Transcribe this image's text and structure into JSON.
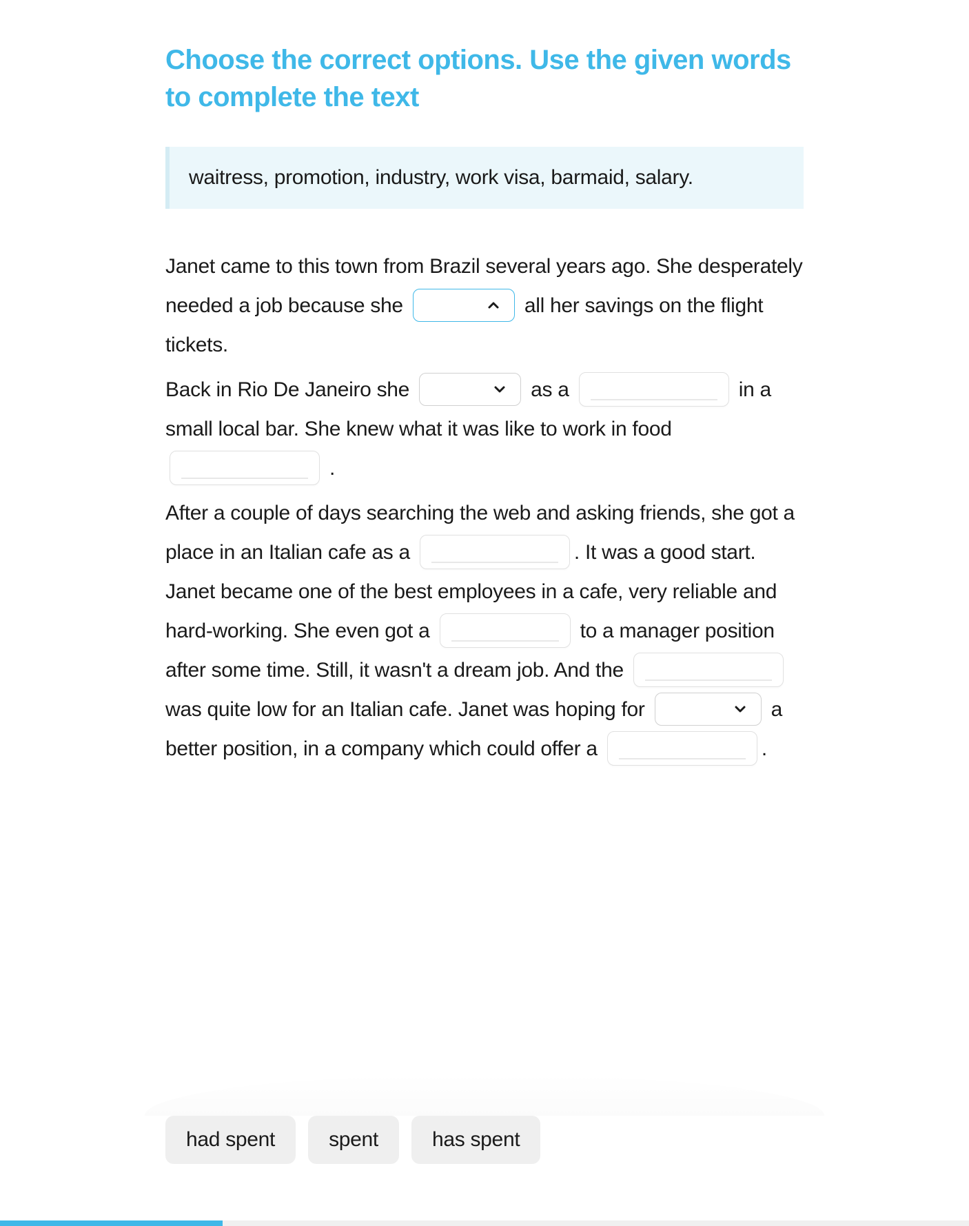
{
  "title": "Choose the correct options. Use the given words to complete the text",
  "word_bank": "waitress, promotion, industry, work visa, barmaid, salary.",
  "text": {
    "p1_a": "Janet came to this town from Brazil several years ago. She desperately needed a job because she ",
    "p1_b": " all her savings on the flight tickets.",
    "p2_a": "Back in Rio De Janeiro she ",
    "p2_b": " as a ",
    "p2_c": " in a small local bar. She knew what it was like to work in food ",
    "p2_d": " .",
    "p3_a": "After a couple of days searching the web and asking friends, she got a place in an Italian cafe as a ",
    "p3_b": ". It was a good start. Janet became one of the best employees in a cafe, very reliable and hard-working. She even got a ",
    "p3_c": " to a manager position after some time. Still, it wasn't a dream job. And the ",
    "p3_d": " was quite low for an Italian cafe. Janet was hoping for ",
    "p3_e": " a better position, in a company which could offer a ",
    "p3_f": "."
  },
  "dropdowns": {
    "d1": {
      "open": true,
      "value": ""
    },
    "d2": {
      "open": false,
      "value": ""
    },
    "d3": {
      "open": false,
      "value": ""
    }
  },
  "inputs": {
    "barmaid": "",
    "industry": "",
    "waitress": "",
    "promotion": "",
    "salary": "",
    "work_visa": ""
  },
  "answer_options": [
    "had spent",
    "spent",
    "has spent"
  ],
  "progress_percent": 23,
  "colors": {
    "accent": "#3FB8E8",
    "bank_bg": "#EBF7FB",
    "option_bg": "#EFEFEF"
  }
}
